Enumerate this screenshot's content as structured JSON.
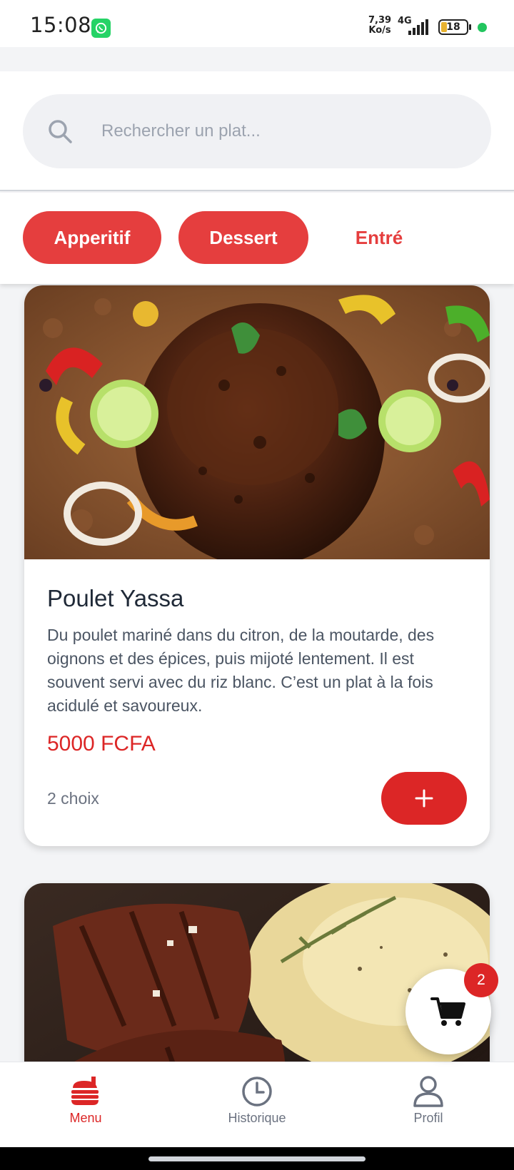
{
  "status_bar": {
    "time": "15:08",
    "net_speed_value": "7,39",
    "net_speed_unit": "Ko/s",
    "network": "4G",
    "battery": "18"
  },
  "search": {
    "placeholder": "Rechercher un plat..."
  },
  "categories": [
    {
      "label": "Apperitif",
      "active": true
    },
    {
      "label": "Dessert",
      "active": true
    },
    {
      "label": "Entré",
      "active": false
    }
  ],
  "dishes": [
    {
      "name": "Poulet Yassa",
      "description": "Du poulet mariné dans du citron, de la moutarde, des oignons et des épices, puis mijoté lentement. Il est souvent servi avec du riz blanc. C’est un plat à la fois acidulé et savoureux.",
      "price": "5000 FCFA",
      "choices": "2 choix",
      "image": "roast-chicken-photo"
    },
    {
      "image": "grilled-meat-mashed-potato-photo"
    }
  ],
  "cart": {
    "count": "2",
    "icon": "cart-icon"
  },
  "nav": [
    {
      "label": "Menu",
      "icon": "burger-icon",
      "active": true
    },
    {
      "label": "Historique",
      "icon": "clock-icon",
      "active": false
    },
    {
      "label": "Profil",
      "icon": "user-icon",
      "active": false
    }
  ],
  "colors": {
    "accent": "#dc2626",
    "chip": "#e53e3e",
    "background": "#f3f4f6"
  }
}
